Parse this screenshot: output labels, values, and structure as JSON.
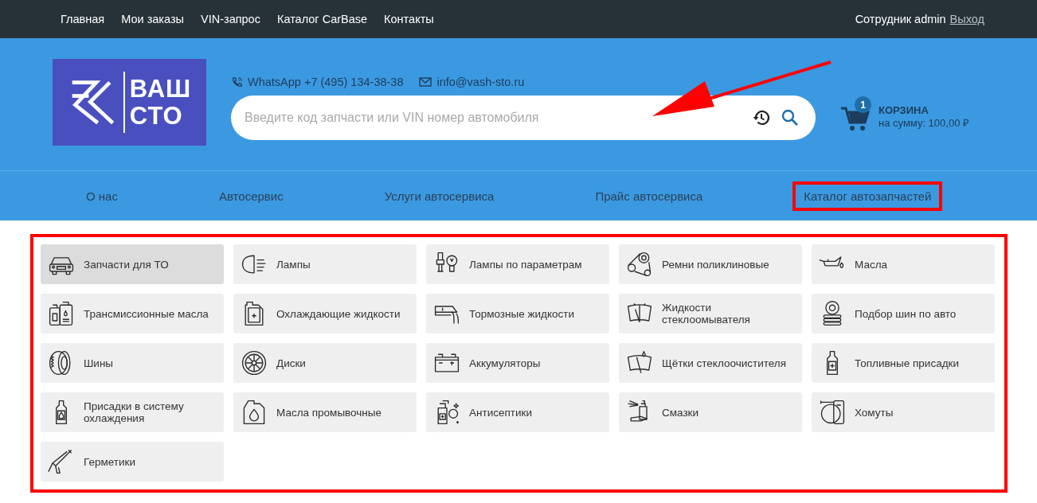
{
  "top_nav": {
    "links": [
      "Главная",
      "Мои заказы",
      "VIN-запрос",
      "Каталог CarBase",
      "Контакты"
    ],
    "user_label": "Сотрудник admin",
    "logout": "Выход"
  },
  "header": {
    "logo": {
      "line_1": "ВАШ",
      "line_2": "СТО"
    },
    "whatsapp": "WhatsApp +7 (495) 134-38-38",
    "email": "info@vash-sto.ru",
    "search": {
      "placeholder": "Введите код запчасти или VIN номер автомобиля"
    },
    "cart": {
      "badge": "1",
      "title": "КОРЗИНА",
      "sum": "на сумму: 100,00 ₽"
    }
  },
  "main_nav": [
    {
      "label": "О нас",
      "highlighted": false
    },
    {
      "label": "Автосервис",
      "highlighted": false
    },
    {
      "label": "Услуги автосервиса",
      "highlighted": false
    },
    {
      "label": "Прайс автосервиса",
      "highlighted": false
    },
    {
      "label": "Каталог автозапчастей",
      "highlighted": true
    }
  ],
  "categories": [
    {
      "label": "Запчасти для ТО",
      "selected": true
    },
    {
      "label": "Лампы",
      "selected": false
    },
    {
      "label": "Лампы по параметрам",
      "selected": false
    },
    {
      "label": "Ремни поликлиновые",
      "selected": false
    },
    {
      "label": "Масла",
      "selected": false
    },
    {
      "label": "Трансмиссионные масла",
      "selected": false
    },
    {
      "label": "Охлаждающие жидкости",
      "selected": false
    },
    {
      "label": "Тормозные жидкости",
      "selected": false
    },
    {
      "label": "Жидкости стеклоомывателя",
      "selected": false
    },
    {
      "label": "Подбор шин по авто",
      "selected": false
    },
    {
      "label": "Шины",
      "selected": false
    },
    {
      "label": "Диски",
      "selected": false
    },
    {
      "label": "Аккумуляторы",
      "selected": false
    },
    {
      "label": "Щётки стеклоочистителя",
      "selected": false
    },
    {
      "label": "Топливные присадки",
      "selected": false
    },
    {
      "label": "Присадки в систему охлаждения",
      "selected": false
    },
    {
      "label": "Масла промывочные",
      "selected": false
    },
    {
      "label": "Антисептики",
      "selected": false
    },
    {
      "label": "Смазки",
      "selected": false
    },
    {
      "label": "Хомуты",
      "selected": false
    },
    {
      "label": "Герметики",
      "selected": false
    }
  ]
}
